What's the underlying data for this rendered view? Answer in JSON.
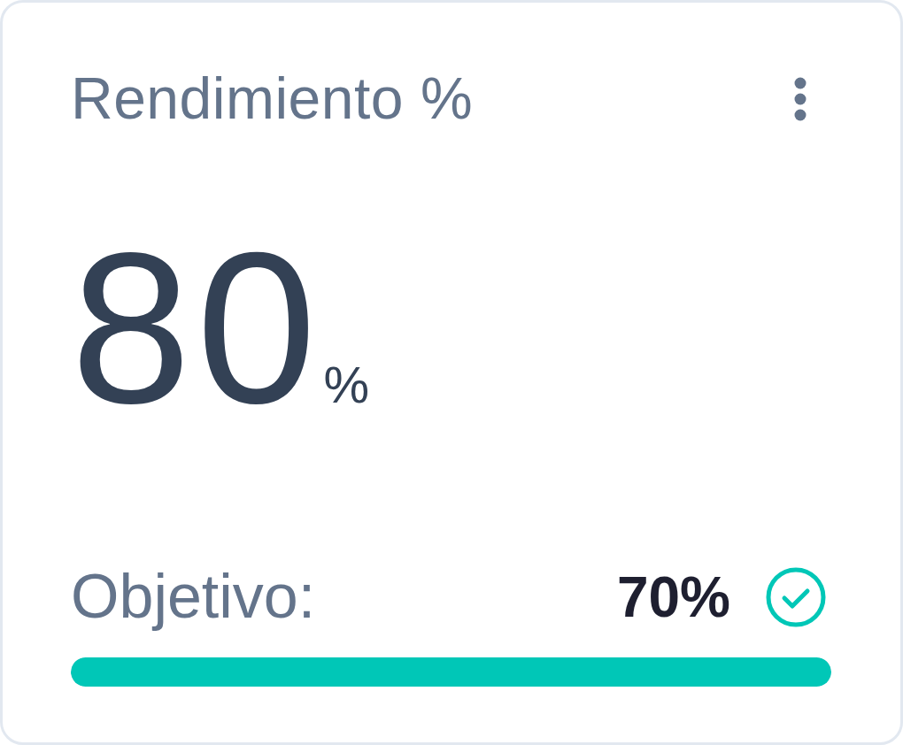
{
  "card": {
    "title": "Rendimiento %",
    "value": "80",
    "unit": "%",
    "target": {
      "label": "Objetivo:",
      "value": "70%",
      "met": true
    },
    "progress": {
      "level": 1
    }
  }
}
